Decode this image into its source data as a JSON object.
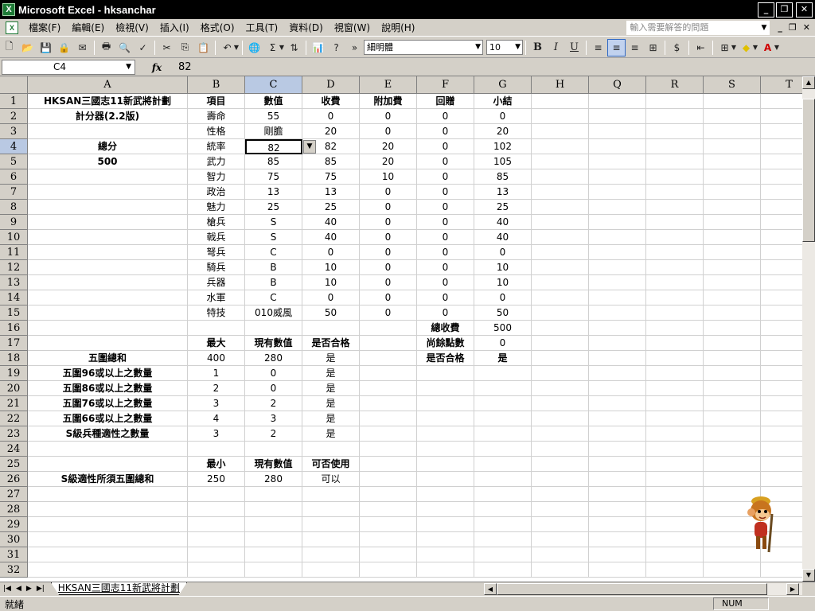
{
  "window": {
    "title": "Microsoft Excel - hksanchar"
  },
  "menubar": {
    "items": [
      "檔案(F)",
      "編輯(E)",
      "檢視(V)",
      "插入(I)",
      "格式(O)",
      "工具(T)",
      "資料(D)",
      "視窗(W)",
      "說明(H)"
    ],
    "help_placeholder": "輸入需要解答的問題"
  },
  "toolbar": {
    "font_name": "細明體",
    "font_size": "10"
  },
  "formula_bar": {
    "cell_ref": "C4",
    "fx": "fx",
    "value": "82"
  },
  "sheet": {
    "columns": [
      "A",
      "B",
      "C",
      "D",
      "E",
      "F",
      "G",
      "H",
      "Q",
      "R",
      "S",
      "T"
    ],
    "selected_column": "C",
    "selected_row": 4,
    "row_numbers": [
      1,
      2,
      3,
      4,
      5,
      6,
      7,
      8,
      9,
      10,
      11,
      12,
      13,
      14,
      15,
      16,
      17,
      18,
      19,
      20,
      21,
      22,
      23,
      24,
      25,
      26,
      27,
      28,
      29,
      30,
      31,
      32
    ],
    "rows": [
      [
        "HKSAN三國志11新武將計劃",
        "項目",
        "數值",
        "收費",
        "附加費",
        "回贈",
        "小結"
      ],
      [
        "計分器(2.2版)",
        "壽命",
        "55",
        "0",
        "0",
        "0",
        "0"
      ],
      [
        "",
        "性格",
        "剛膽",
        "20",
        "0",
        "0",
        "20"
      ],
      [
        "總分",
        "統率",
        "82",
        "82",
        "20",
        "0",
        "102"
      ],
      [
        "500",
        "武力",
        "85",
        "85",
        "20",
        "0",
        "105"
      ],
      [
        "",
        "智力",
        "75",
        "75",
        "10",
        "0",
        "85"
      ],
      [
        "",
        "政治",
        "13",
        "13",
        "0",
        "0",
        "13"
      ],
      [
        "",
        "魅力",
        "25",
        "25",
        "0",
        "0",
        "25"
      ],
      [
        "",
        "槍兵",
        "S",
        "40",
        "0",
        "0",
        "40"
      ],
      [
        "",
        "戟兵",
        "S",
        "40",
        "0",
        "0",
        "40"
      ],
      [
        "",
        "弩兵",
        "C",
        "0",
        "0",
        "0",
        "0"
      ],
      [
        "",
        "騎兵",
        "B",
        "10",
        "0",
        "0",
        "10"
      ],
      [
        "",
        "兵器",
        "B",
        "10",
        "0",
        "0",
        "10"
      ],
      [
        "",
        "水軍",
        "C",
        "0",
        "0",
        "0",
        "0"
      ],
      [
        "",
        "特技",
        "010威風",
        "50",
        "0",
        "0",
        "50"
      ],
      [
        "",
        "",
        "",
        "",
        "",
        "總收費",
        "500"
      ],
      [
        "",
        "最大",
        "現有數值",
        "是否合格",
        "",
        "尚餘點數",
        "0"
      ],
      [
        "五圍總和",
        "400",
        "280",
        "是",
        "",
        "是否合格",
        "是"
      ],
      [
        "五圍96或以上之數量",
        "1",
        "0",
        "是",
        "",
        "",
        ""
      ],
      [
        "五圍86或以上之數量",
        "2",
        "0",
        "是",
        "",
        "",
        ""
      ],
      [
        "五圍76或以上之數量",
        "3",
        "2",
        "是",
        "",
        "",
        ""
      ],
      [
        "五圍66或以上之數量",
        "4",
        "3",
        "是",
        "",
        "",
        ""
      ],
      [
        "S級兵種適性之數量",
        "3",
        "2",
        "是",
        "",
        "",
        ""
      ],
      [
        "",
        "",
        "",
        "",
        "",
        "",
        ""
      ],
      [
        "",
        "最小",
        "現有數值",
        "可否使用",
        "",
        "",
        ""
      ],
      [
        "S級適性所須五圍總和",
        "250",
        "280",
        "可以",
        "",
        "",
        ""
      ]
    ],
    "tab_name": "HKSAN三國志11新武將計劃"
  },
  "status": {
    "text": "就緒",
    "num": "NUM"
  }
}
